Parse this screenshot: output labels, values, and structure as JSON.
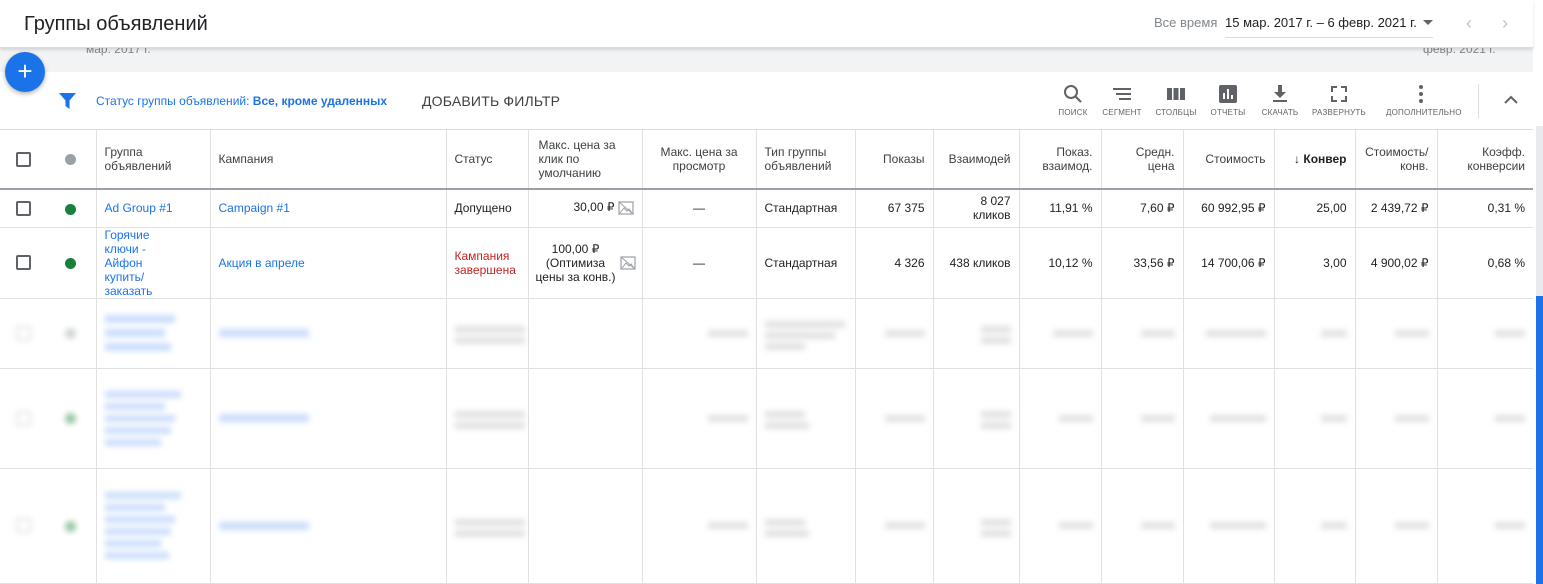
{
  "header": {
    "title": "Группы объявлений",
    "range_label": "Все время",
    "date_range": "15 мар. 2017 г. – 6 февр. 2021 г.",
    "ghost_left": "мар. 2017 г.",
    "ghost_right": "февр. 2021 г."
  },
  "filterbar": {
    "status_prefix": "Статус группы объявлений:",
    "status_value": "Все, кроме удаленных",
    "add_filter": "ДОБАВИТЬ ФИЛЬТР"
  },
  "toolbar": {
    "search": "ПОИСК",
    "segment": "СЕГМЕНТ",
    "columns": "СТОЛБЦЫ",
    "reports": "ОТЧЕТЫ",
    "download": "СКАЧАТЬ",
    "expand": "РАЗВЕРНУТЬ",
    "more": "ДОПОЛНИТЕЛЬНО"
  },
  "table": {
    "headers": {
      "ad_group": "Группа объявлений",
      "campaign": "Кампания",
      "status": "Статус",
      "max_cpc": "Макс. цена за клик по умолчанию",
      "max_cpv": "Макс. цена за просмотр",
      "ad_group_type": "Тип группы объявлений",
      "impressions": "Показы",
      "interactions": "Взаимодей",
      "interaction_rate": "Показ. взаимод.",
      "avg_cost": "Средн. цена",
      "cost": "Стоимость",
      "conversions": "Конвер",
      "cost_per_conv": "Стоимость/ конв.",
      "conv_rate": "Коэфф. конверсии"
    },
    "rows": [
      {
        "status_color": "#188038",
        "ad_group": "Ad Group #1",
        "campaign": "Campaign #1",
        "status": "Допущено",
        "max_cpc": "30,00 ₽",
        "max_cpv": "—",
        "type": "Стандартная",
        "impressions": "67 375",
        "interactions": "8 027 кликов",
        "interaction_rate": "11,91 %",
        "avg_cost": "7,60 ₽",
        "cost": "60 992,95 ₽",
        "conversions": "25,00",
        "cost_per_conv": "2 439,72 ₽",
        "conv_rate": "0,31 %"
      },
      {
        "status_color": "#188038",
        "ad_group": "Горячие ключи - Айфон купить/ заказать",
        "campaign": "Акция в апреле",
        "status": "Кампания завершена",
        "max_cpc": "100,00 ₽ (Оптимиза цены за конв.)",
        "max_cpv": "—",
        "type": "Стандартная",
        "impressions": "4 326",
        "interactions": "438 кликов",
        "interaction_rate": "10,12 %",
        "avg_cost": "33,56 ₽",
        "cost": "14 700,06 ₽",
        "conversions": "3,00",
        "cost_per_conv": "4 900,02 ₽",
        "conv_rate": "0,68 %"
      }
    ]
  },
  "colors": {
    "accent": "#1a73e8",
    "active_status": "#188038",
    "ended_status": "#c5221f"
  }
}
